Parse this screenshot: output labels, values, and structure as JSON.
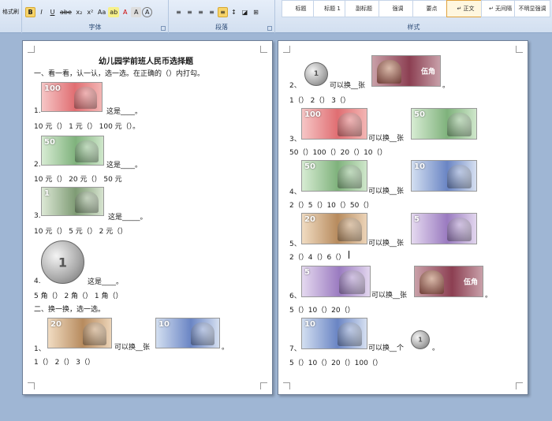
{
  "ribbon": {
    "clipboard": {
      "format_painter": "格式刷"
    },
    "font": {
      "group_title": "字体",
      "buttons": [
        "B",
        "I",
        "U",
        "abe",
        "x₂",
        "x²",
        "Aa",
        "ab",
        "A",
        "A",
        "A"
      ]
    },
    "paragraph": {
      "group_title": "段落"
    },
    "styles": {
      "group_title": "样式",
      "items": [
        "标题",
        "标题 1",
        "副标题",
        "强调",
        "要点",
        "↵ 正文",
        "↵ 无间隔",
        "不明显强调"
      ]
    }
  },
  "doc": {
    "left": {
      "title": "幼儿园学前班人民币选择题",
      "section1": "一、看一看，认一认，选一选。在正确的（）内打勾。",
      "q1": "1.",
      "q1_text": "这是____。",
      "q1_opts": "10 元（）      1 元（）      100 元（）。",
      "q2": "2.",
      "q2_text": "这是____。",
      "q2_opts": "10 元（）     20 元（）     50 元",
      "q3": "3.",
      "q3_text": "这是_____。",
      "q3_opts": "10 元（）  5 元（） 2 元（）",
      "q4": "4.",
      "q4_text": "这是____。",
      "q4_opts": "5 角（） 2 角（） 1 角（）",
      "section2": "二、换一换，选一选。",
      "ex1": "1、",
      "ex1_text": "可以换__张",
      "ex1_end": "。",
      "ex1_opts": "1（） 2（） 3（）"
    },
    "right": {
      "ex2": "2、",
      "ex2_text": "可以换__张",
      "ex2_end": "。",
      "ex2_opts": "1（） 2（） 3（）",
      "ex3": "3、",
      "ex3_text": "可以换__张",
      "ex3_opts": "50（）100（）20（）10（）",
      "ex4": "4、",
      "ex4_text": "可以换__张",
      "ex4_opts": "2（）5（）10（）50（）",
      "ex5": "5、",
      "ex5_text": "可以换__张",
      "ex5_opts": "2（）4（）6（）",
      "ex6": "6、",
      "ex6_text": "可以换__张",
      "ex6_end": "。",
      "ex6_opts": "5（）10（）20（）",
      "ex7": "7、",
      "ex7_text": "可以换__个",
      "ex7_end": "。",
      "ex7_opts": "5（）10（）20（）100（）"
    }
  },
  "money_labels": {
    "n100": "100",
    "n50": "50",
    "n20": "20",
    "n10": "10",
    "n5": "5",
    "n1": "1",
    "jiao5": "伍角",
    "coin1": "1"
  },
  "colors": {
    "workspace": "#9fb6d4",
    "ribbon": "#d2dff0",
    "accent": "#f7d46a"
  }
}
